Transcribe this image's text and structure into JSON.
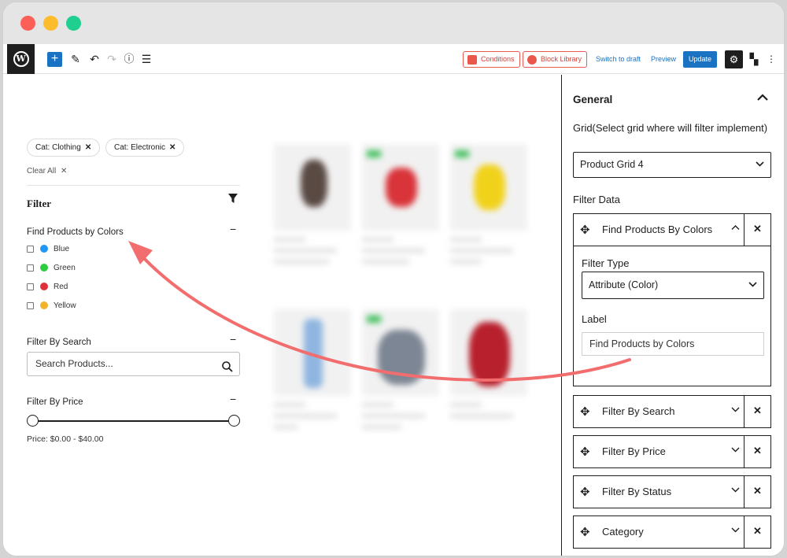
{
  "toolbar": {
    "conditions_label": "Conditions",
    "block_library_label": "Block Library",
    "switch_to_draft_label": "Switch to draft",
    "preview_label": "Preview",
    "update_label": "Update",
    "add_symbol": "+",
    "wp_symbol": "W"
  },
  "canvas": {
    "chips": [
      {
        "label": "Cat: Clothing",
        "remove": "✕"
      },
      {
        "label": "Cat: Electronic",
        "remove": "✕"
      }
    ],
    "clear_all_label": "Clear All",
    "clear_all_remove": "✕",
    "filter_heading": "Filter",
    "colors_section": {
      "title": "Find Products by Colors",
      "options": [
        {
          "label": "Blue",
          "color": "#2196f3"
        },
        {
          "label": "Green",
          "color": "#2ecc40"
        },
        {
          "label": "Red",
          "color": "#e0313a"
        },
        {
          "label": "Yellow",
          "color": "#f0b429"
        }
      ]
    },
    "search_section": {
      "title": "Filter By Search",
      "placeholder": "Search Products..."
    },
    "price_section": {
      "title": "Filter By Price",
      "price_text": "Price: $0.00 - $40.00"
    },
    "collapse_symbol": "−"
  },
  "sidebar": {
    "general_title": "General",
    "grid_label": "Grid(Select grid where will filter implement)",
    "grid_value": "Product Grid 4",
    "filter_data_label": "Filter Data",
    "expanded_item": {
      "title": "Find Products By Colors",
      "filter_type_label": "Filter Type",
      "filter_type_value": "Attribute (Color)",
      "label_label": "Label",
      "label_value": "Find Products by Colors"
    },
    "collapsed_items": [
      {
        "title": "Filter By Search"
      },
      {
        "title": "Filter By Price"
      },
      {
        "title": "Filter By Status"
      },
      {
        "title": "Category"
      }
    ]
  },
  "colors": {
    "accent": "#1a73c2",
    "annotation_arrow": "#f26d6d",
    "conditions_red": "#e8584c"
  }
}
